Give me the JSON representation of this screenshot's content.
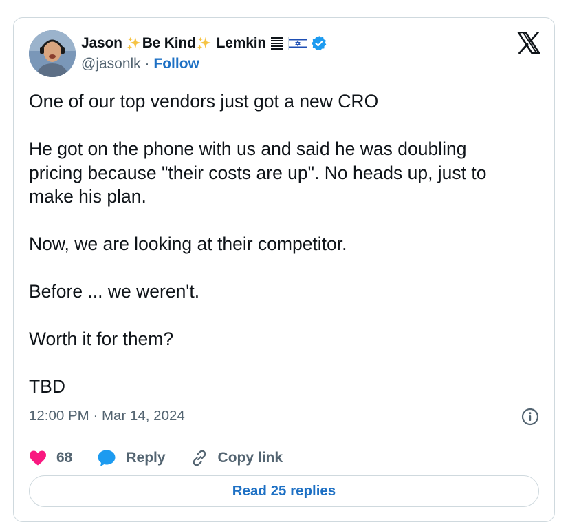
{
  "author": {
    "name_first": "Jason",
    "name_middle": "Be Kind",
    "name_last": "Lemkin",
    "handle": "@jasonlk",
    "separator": "·",
    "follow_label": "Follow",
    "icons": [
      "sparkles-icon",
      "sparkles-icon",
      "list-icon",
      "israel-flag-icon",
      "verified-badge-icon"
    ]
  },
  "logo": "x-logo",
  "tweet": {
    "paragraphs": [
      [
        "One of our top vendors just got a new CRO"
      ],
      [
        "He got on the phone with us and said he was doubling",
        "pricing because \"their costs are up\".  No heads up, just to",
        "make his plan."
      ],
      [
        "Now, we are looking at their competitor."
      ],
      [
        "Before ... we weren't."
      ],
      [
        "Worth it for them?"
      ],
      [
        "TBD"
      ]
    ]
  },
  "timestamp": {
    "time": "12:00 PM",
    "separator": "·",
    "date": "Mar 14, 2024"
  },
  "actions": {
    "like_count": "68",
    "reply_label": "Reply",
    "copy_link_label": "Copy link"
  },
  "read_replies_label": "Read 25 replies",
  "colors": {
    "accent": "#1d70c4",
    "like": "#f91880",
    "reply_icon": "#1d9bf0",
    "secondary_text": "#536471",
    "border": "#cfd9de",
    "verified": "#1d9bf0"
  }
}
